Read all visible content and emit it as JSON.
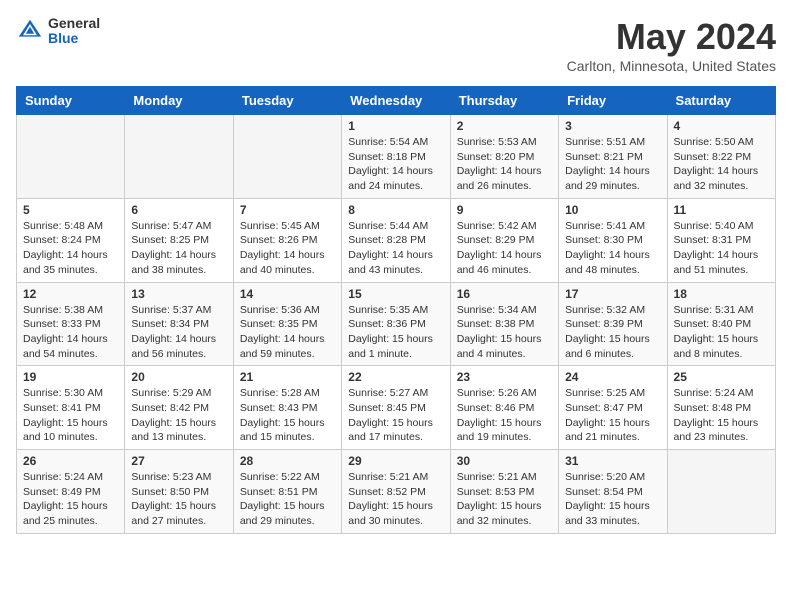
{
  "header": {
    "logo_general": "General",
    "logo_blue": "Blue",
    "month_title": "May 2024",
    "location": "Carlton, Minnesota, United States"
  },
  "weekdays": [
    "Sunday",
    "Monday",
    "Tuesday",
    "Wednesday",
    "Thursday",
    "Friday",
    "Saturday"
  ],
  "weeks": [
    [
      {
        "day": "",
        "sunrise": "",
        "sunset": "",
        "daylight": ""
      },
      {
        "day": "",
        "sunrise": "",
        "sunset": "",
        "daylight": ""
      },
      {
        "day": "",
        "sunrise": "",
        "sunset": "",
        "daylight": ""
      },
      {
        "day": "1",
        "sunrise": "Sunrise: 5:54 AM",
        "sunset": "Sunset: 8:18 PM",
        "daylight": "Daylight: 14 hours and 24 minutes."
      },
      {
        "day": "2",
        "sunrise": "Sunrise: 5:53 AM",
        "sunset": "Sunset: 8:20 PM",
        "daylight": "Daylight: 14 hours and 26 minutes."
      },
      {
        "day": "3",
        "sunrise": "Sunrise: 5:51 AM",
        "sunset": "Sunset: 8:21 PM",
        "daylight": "Daylight: 14 hours and 29 minutes."
      },
      {
        "day": "4",
        "sunrise": "Sunrise: 5:50 AM",
        "sunset": "Sunset: 8:22 PM",
        "daylight": "Daylight: 14 hours and 32 minutes."
      }
    ],
    [
      {
        "day": "5",
        "sunrise": "Sunrise: 5:48 AM",
        "sunset": "Sunset: 8:24 PM",
        "daylight": "Daylight: 14 hours and 35 minutes."
      },
      {
        "day": "6",
        "sunrise": "Sunrise: 5:47 AM",
        "sunset": "Sunset: 8:25 PM",
        "daylight": "Daylight: 14 hours and 38 minutes."
      },
      {
        "day": "7",
        "sunrise": "Sunrise: 5:45 AM",
        "sunset": "Sunset: 8:26 PM",
        "daylight": "Daylight: 14 hours and 40 minutes."
      },
      {
        "day": "8",
        "sunrise": "Sunrise: 5:44 AM",
        "sunset": "Sunset: 8:28 PM",
        "daylight": "Daylight: 14 hours and 43 minutes."
      },
      {
        "day": "9",
        "sunrise": "Sunrise: 5:42 AM",
        "sunset": "Sunset: 8:29 PM",
        "daylight": "Daylight: 14 hours and 46 minutes."
      },
      {
        "day": "10",
        "sunrise": "Sunrise: 5:41 AM",
        "sunset": "Sunset: 8:30 PM",
        "daylight": "Daylight: 14 hours and 48 minutes."
      },
      {
        "day": "11",
        "sunrise": "Sunrise: 5:40 AM",
        "sunset": "Sunset: 8:31 PM",
        "daylight": "Daylight: 14 hours and 51 minutes."
      }
    ],
    [
      {
        "day": "12",
        "sunrise": "Sunrise: 5:38 AM",
        "sunset": "Sunset: 8:33 PM",
        "daylight": "Daylight: 14 hours and 54 minutes."
      },
      {
        "day": "13",
        "sunrise": "Sunrise: 5:37 AM",
        "sunset": "Sunset: 8:34 PM",
        "daylight": "Daylight: 14 hours and 56 minutes."
      },
      {
        "day": "14",
        "sunrise": "Sunrise: 5:36 AM",
        "sunset": "Sunset: 8:35 PM",
        "daylight": "Daylight: 14 hours and 59 minutes."
      },
      {
        "day": "15",
        "sunrise": "Sunrise: 5:35 AM",
        "sunset": "Sunset: 8:36 PM",
        "daylight": "Daylight: 15 hours and 1 minute."
      },
      {
        "day": "16",
        "sunrise": "Sunrise: 5:34 AM",
        "sunset": "Sunset: 8:38 PM",
        "daylight": "Daylight: 15 hours and 4 minutes."
      },
      {
        "day": "17",
        "sunrise": "Sunrise: 5:32 AM",
        "sunset": "Sunset: 8:39 PM",
        "daylight": "Daylight: 15 hours and 6 minutes."
      },
      {
        "day": "18",
        "sunrise": "Sunrise: 5:31 AM",
        "sunset": "Sunset: 8:40 PM",
        "daylight": "Daylight: 15 hours and 8 minutes."
      }
    ],
    [
      {
        "day": "19",
        "sunrise": "Sunrise: 5:30 AM",
        "sunset": "Sunset: 8:41 PM",
        "daylight": "Daylight: 15 hours and 10 minutes."
      },
      {
        "day": "20",
        "sunrise": "Sunrise: 5:29 AM",
        "sunset": "Sunset: 8:42 PM",
        "daylight": "Daylight: 15 hours and 13 minutes."
      },
      {
        "day": "21",
        "sunrise": "Sunrise: 5:28 AM",
        "sunset": "Sunset: 8:43 PM",
        "daylight": "Daylight: 15 hours and 15 minutes."
      },
      {
        "day": "22",
        "sunrise": "Sunrise: 5:27 AM",
        "sunset": "Sunset: 8:45 PM",
        "daylight": "Daylight: 15 hours and 17 minutes."
      },
      {
        "day": "23",
        "sunrise": "Sunrise: 5:26 AM",
        "sunset": "Sunset: 8:46 PM",
        "daylight": "Daylight: 15 hours and 19 minutes."
      },
      {
        "day": "24",
        "sunrise": "Sunrise: 5:25 AM",
        "sunset": "Sunset: 8:47 PM",
        "daylight": "Daylight: 15 hours and 21 minutes."
      },
      {
        "day": "25",
        "sunrise": "Sunrise: 5:24 AM",
        "sunset": "Sunset: 8:48 PM",
        "daylight": "Daylight: 15 hours and 23 minutes."
      }
    ],
    [
      {
        "day": "26",
        "sunrise": "Sunrise: 5:24 AM",
        "sunset": "Sunset: 8:49 PM",
        "daylight": "Daylight: 15 hours and 25 minutes."
      },
      {
        "day": "27",
        "sunrise": "Sunrise: 5:23 AM",
        "sunset": "Sunset: 8:50 PM",
        "daylight": "Daylight: 15 hours and 27 minutes."
      },
      {
        "day": "28",
        "sunrise": "Sunrise: 5:22 AM",
        "sunset": "Sunset: 8:51 PM",
        "daylight": "Daylight: 15 hours and 29 minutes."
      },
      {
        "day": "29",
        "sunrise": "Sunrise: 5:21 AM",
        "sunset": "Sunset: 8:52 PM",
        "daylight": "Daylight: 15 hours and 30 minutes."
      },
      {
        "day": "30",
        "sunrise": "Sunrise: 5:21 AM",
        "sunset": "Sunset: 8:53 PM",
        "daylight": "Daylight: 15 hours and 32 minutes."
      },
      {
        "day": "31",
        "sunrise": "Sunrise: 5:20 AM",
        "sunset": "Sunset: 8:54 PM",
        "daylight": "Daylight: 15 hours and 33 minutes."
      },
      {
        "day": "",
        "sunrise": "",
        "sunset": "",
        "daylight": ""
      }
    ]
  ]
}
